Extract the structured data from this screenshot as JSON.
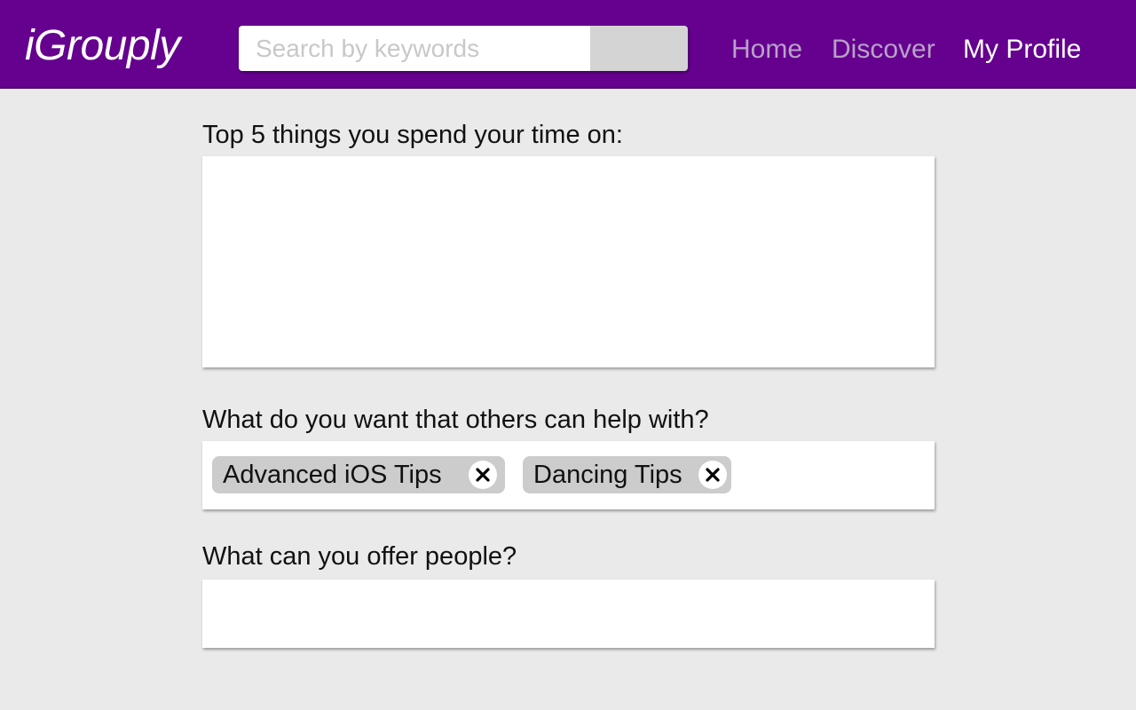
{
  "header": {
    "logo": "iGrouply",
    "search_placeholder": "Search by keywords",
    "nav": {
      "home": "Home",
      "discover": "Discover",
      "my_profile": "My Profile"
    }
  },
  "form": {
    "top5": {
      "label": "Top 5 things you spend your time on:",
      "value": ""
    },
    "want_help": {
      "label": "What do you want that others can help with?",
      "tags": [
        "Advanced iOS Tips",
        "Dancing Tips"
      ]
    },
    "offer": {
      "label": "What can you offer people?",
      "value": ""
    }
  },
  "colors": {
    "header_bg": "#65008f",
    "page_bg": "#eaeaea",
    "tag_bg": "#cccccc",
    "nav_inactive": "#b8a2c6",
    "nav_active": "#ffffff"
  },
  "icons": {
    "tag_remove": "close-icon"
  }
}
